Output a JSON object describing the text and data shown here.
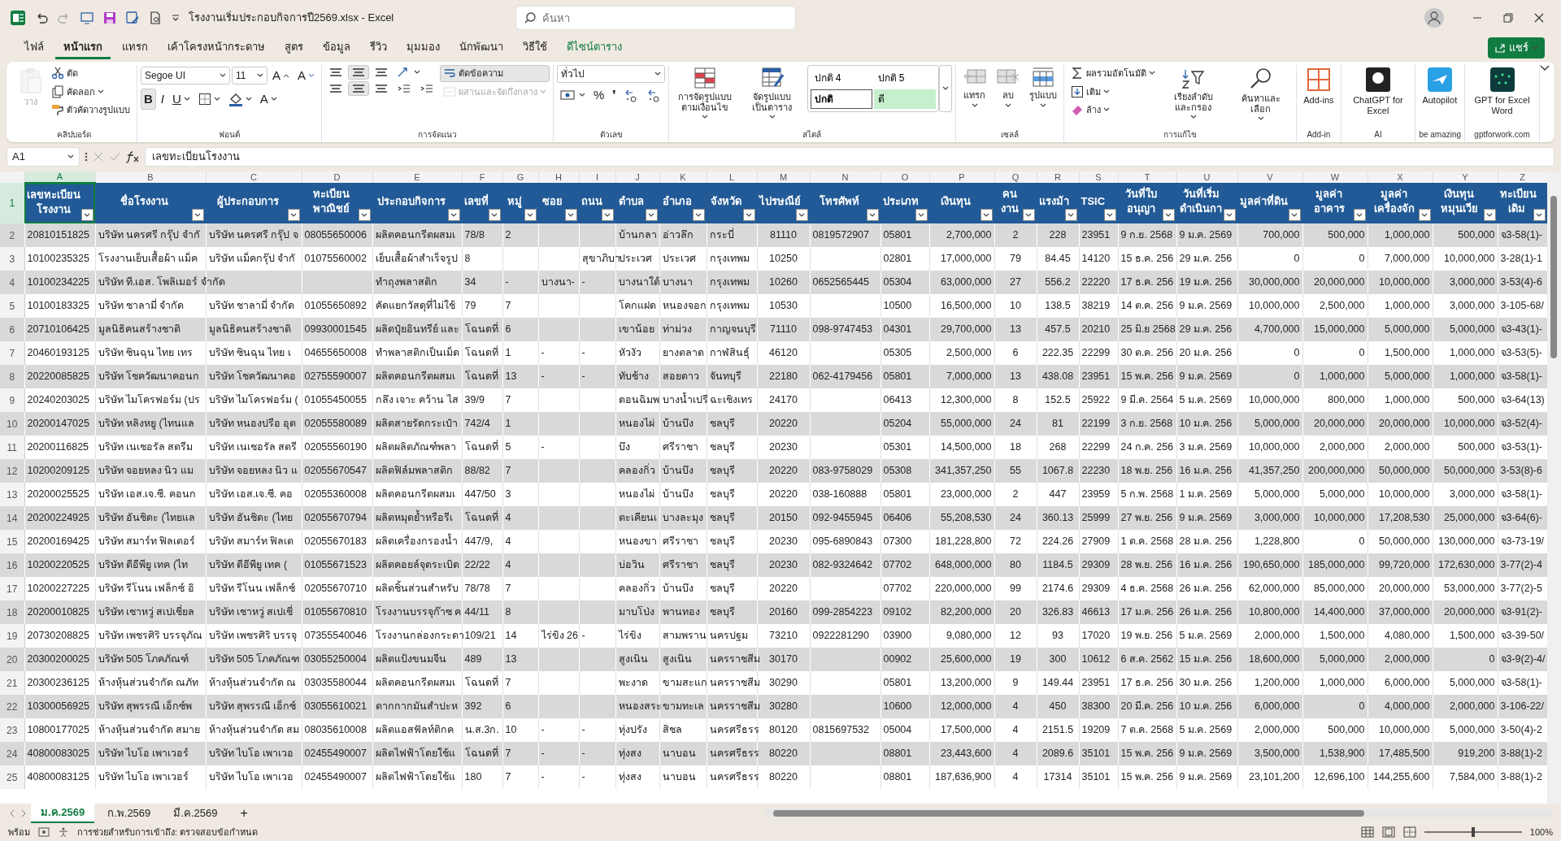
{
  "title_bar": {
    "title": "โรงงานเริ่มประกอบกิจการปี2569.xlsx  -  Excel",
    "search_placeholder": "ค้นหา"
  },
  "menu_tabs": [
    {
      "label": "ไฟล์",
      "selected": false,
      "kind": "tab"
    },
    {
      "label": "หน้าแรก",
      "selected": true,
      "kind": "tab"
    },
    {
      "label": "แทรก",
      "selected": false,
      "kind": "tab"
    },
    {
      "label": "เค้าโครงหน้ากระดาษ",
      "selected": false,
      "kind": "tab"
    },
    {
      "label": "สูตร",
      "selected": false,
      "kind": "tab"
    },
    {
      "label": "ข้อมูล",
      "selected": false,
      "kind": "tab"
    },
    {
      "label": "รีวิว",
      "selected": false,
      "kind": "tab"
    },
    {
      "label": "มุมมอง",
      "selected": false,
      "kind": "tab"
    },
    {
      "label": "นักพัฒนา",
      "selected": false,
      "kind": "tab"
    },
    {
      "label": "วิธีใช้",
      "selected": false,
      "kind": "tab"
    },
    {
      "label": "ดีไซน์ตาราง",
      "selected": false,
      "kind": "contextual"
    }
  ],
  "share_button": "แชร์",
  "ribbon": [
    {
      "label": "คลิปบอร์ด",
      "columns": [
        [
          {
            "kind": "paste",
            "label": "วาง",
            "disabled": true
          }
        ],
        [
          {
            "kind": "cut",
            "label": "ตัด",
            "disabled": false
          },
          {
            "kind": "copy",
            "label": "คัดลอก",
            "disabled": false
          },
          {
            "kind": "painter",
            "label": "ตัวคัดวางรูปแบบ",
            "disabled": false
          }
        ]
      ]
    },
    {
      "label": "ฟอนต์",
      "columns": [
        [
          [
            {
              "kind": "combo",
              "value": "Segoe UI",
              "disabled": false
            },
            {
              "kind": "combo",
              "value": "11",
              "disabled": false
            },
            {
              "kind": "grow",
              "label": "A",
              "disabled": false
            },
            {
              "kind": "shrink",
              "label": "A",
              "disabled": false
            }
          ],
          [
            {
              "kind": "bold",
              "label": "B",
              "on": true,
              "disabled": false
            },
            {
              "kind": "italic",
              "label": "I",
              "on": false,
              "disabled": false
            },
            {
              "kind": "underline",
              "label": "U",
              "on": false,
              "disabled": false
            },
            {
              "kind": "borders",
              "disabled": false
            },
            {
              "kind": "fill",
              "disabled": false
            },
            {
              "kind": "fontcolor",
              "label": "A",
              "disabled": false
            }
          ]
        ]
      ]
    },
    {
      "label": "การจัดแนว",
      "columns": [
        [
          [
            {
              "kind": "align",
              "on": false,
              "disabled": false
            },
            {
              "kind": "align",
              "on": true,
              "disabled": false
            },
            {
              "kind": "align",
              "on": false,
              "disabled": false
            },
            {
              "kind": "orient",
              "on": false,
              "disabled": false
            }
          ],
          [
            {
              "kind": "align",
              "on": false,
              "disabled": false
            },
            {
              "kind": "align",
              "on": true,
              "disabled": false
            },
            {
              "kind": "align",
              "on": false,
              "disabled": false
            },
            {
              "kind": "indent",
              "on": false,
              "disabled": false
            },
            {
              "kind": "indent",
              "on": false,
              "disabled": false
            }
          ]
        ],
        [
          {
            "kind": "wrap",
            "label": "ตัดข้อความ",
            "on": true,
            "disabled": false
          },
          {
            "kind": "merge",
            "label": "ผสานและจัดกึ่งกลาง",
            "on": false,
            "disabled": true
          }
        ]
      ]
    },
    {
      "label": "ตัวเลข",
      "columns": [
        [
          {
            "kind": "combo",
            "value": "ทั่วไป",
            "disabled": false
          },
          [
            {
              "kind": "currency",
              "disabled": false
            },
            {
              "kind": "char",
              "label": "%",
              "disabled": false
            },
            {
              "kind": "char",
              "label": "❜",
              "disabled": false
            },
            {
              "kind": "decimal",
              "disabled": false
            },
            {
              "kind": "decimal",
              "disabled": false
            }
          ]
        ]
      ]
    },
    {
      "label": "สไตล์",
      "columns": [
        [
          {
            "kind": "condformat",
            "label": "การจัดรูปแบบ ตามเงื่อนไข",
            "disabled": false
          }
        ],
        [
          {
            "kind": "tableformat",
            "label": "จัดรูปแบบ เป็นตาราง",
            "disabled": false
          }
        ],
        [
          {
            "kind": "gallery",
            "disabled": false,
            "styles": [
              {
                "label": "ปกติ 4",
                "color": "#ffffff",
                "selected": false
              },
              {
                "label": "ปกติ 5",
                "color": "#ffffff",
                "selected": false
              },
              {
                "label": "ปกติ",
                "color": "#ffffff",
                "selected": true
              },
              {
                "label": "ดี",
                "color": "#c6efce",
                "selected": false
              }
            ]
          }
        ]
      ]
    },
    {
      "label": "เซลล์",
      "columns": [
        [
          {
            "kind": "insert",
            "label": "แทรก",
            "disabled": false
          }
        ],
        [
          {
            "kind": "delete",
            "label": "ลบ",
            "disabled": false
          }
        ],
        [
          {
            "kind": "format",
            "label": "รูปแบบ",
            "disabled": false
          }
        ]
      ]
    },
    {
      "label": "การแก้ไข",
      "columns": [
        [
          {
            "kind": "autosum",
            "label": "ผลรวมอัตโนมัติ",
            "disabled": false
          },
          {
            "kind": "filldown",
            "label": "เติม",
            "disabled": false
          },
          {
            "kind": "clear",
            "label": "ล้าง",
            "disabled": false
          }
        ],
        [
          {
            "kind": "sort",
            "label": "เรียงลำดับ และกรอง",
            "disabled": false
          }
        ],
        [
          {
            "kind": "find",
            "label": "ค้นหาและ เลือก",
            "disabled": false
          }
        ]
      ]
    },
    {
      "label": "Add-in",
      "columns": [
        [
          {
            "kind": "addins",
            "label": "Add-ins",
            "disabled": false
          }
        ]
      ]
    },
    {
      "label": "AI",
      "columns": [
        [
          {
            "kind": "chatgpt",
            "label": "ChatGPT for Excel",
            "disabled": false
          }
        ]
      ]
    },
    {
      "label": "be amazing",
      "columns": [
        [
          {
            "kind": "autopilot",
            "label": "Autopilot",
            "disabled": false
          }
        ]
      ]
    },
    {
      "label": "gptforwork.com",
      "columns": [
        [
          {
            "kind": "gptword",
            "label": "GPT for Excel Word",
            "disabled": false
          }
        ]
      ]
    }
  ],
  "formula_bar": {
    "name_box": "A1",
    "content": "เลขทะเบียนโรงงาน"
  },
  "sheet": {
    "columns": [
      {
        "letter": "A",
        "heading": "เลขทะเบียนโรงงาน",
        "selected": true
      },
      {
        "letter": "B",
        "heading": "ชื่อโรงงาน",
        "selected": false
      },
      {
        "letter": "C",
        "heading": "ผู้ประกอบการ",
        "selected": false
      },
      {
        "letter": "D",
        "heading": "ทะเบียนพาณิชย์",
        "selected": false
      },
      {
        "letter": "E",
        "heading": "ประกอบกิจการ",
        "selected": false
      },
      {
        "letter": "F",
        "heading": "เลขที่",
        "selected": false
      },
      {
        "letter": "G",
        "heading": "หมู่",
        "selected": false
      },
      {
        "letter": "H",
        "heading": "ซอย",
        "selected": false
      },
      {
        "letter": "I",
        "heading": "ถนน",
        "selected": false
      },
      {
        "letter": "J",
        "heading": "ตำบล",
        "selected": false
      },
      {
        "letter": "K",
        "heading": "อำเภอ",
        "selected": false
      },
      {
        "letter": "L",
        "heading": "จังหวัด",
        "selected": false
      },
      {
        "letter": "M",
        "heading": "ไปรษณีย์",
        "selected": false
      },
      {
        "letter": "N",
        "heading": "โทรศัพท์",
        "selected": false
      },
      {
        "letter": "O",
        "heading": "ประเภท",
        "selected": false
      },
      {
        "letter": "P",
        "heading": "เงินทุน",
        "selected": false
      },
      {
        "letter": "Q",
        "heading": "คนงาน",
        "selected": false
      },
      {
        "letter": "R",
        "heading": "แรงม้า",
        "selected": false
      },
      {
        "letter": "S",
        "heading": "TSIC",
        "selected": false
      },
      {
        "letter": "T",
        "heading": "วันที่ใบอนุญา",
        "selected": false
      },
      {
        "letter": "U",
        "heading": "วันที่เริ่มดำเนินกา",
        "selected": false
      },
      {
        "letter": "V",
        "heading": "มูลค่าที่ดิน",
        "selected": false
      },
      {
        "letter": "W",
        "heading": "มูลค่าอาคาร",
        "selected": false
      },
      {
        "letter": "X",
        "heading": "มูลค่าเครื่องจัก",
        "selected": false
      },
      {
        "letter": "Y",
        "heading": "เงินทุนหมุนเวีย",
        "selected": false
      },
      {
        "letter": "Z",
        "heading": "ทะเบียนเดิม",
        "selected": false
      }
    ],
    "header_row": {
      "number": "1",
      "selected": true
    },
    "rows": [
      {
        "number": "2",
        "selected": false,
        "cells": [
          "20810151825",
          "บริษัท นครศรี กรุ๊ป จำกั",
          "บริษัท นครศรี กรุ๊ป จ",
          "08055650006",
          "ผลิตคอนกรีตผสมเ",
          "78/8",
          "2",
          "",
          "",
          "บ้านกลา",
          "อ่าวลึก",
          "กระบี่",
          "81110",
          "0819572907",
          "05801",
          "2,700,000",
          "2",
          "228",
          "23951",
          "9 ก.ย. 2568",
          "9 ม.ค. 2569",
          "700,000",
          "500,000",
          "1,000,000",
          "500,000",
          "จ3-58(1)-"
        ]
      },
      {
        "number": "3",
        "selected": false,
        "cells": [
          "10100235325",
          "โรงงานเย็บเสื้อผ้า แม็ค",
          "บริษัท  แม็คกรุ๊ป จำกั",
          "01075560002",
          "เย็บเสื้อผ้าสำเร็จรูป",
          "8",
          "",
          "",
          "สุขาภิบา",
          "ประเวศ",
          "ประเวศ",
          "กรุงเทพม",
          "10250",
          "",
          "02801",
          "17,000,000",
          "79",
          "84.45",
          "14120",
          "15 ธ.ค. 256",
          "29 ม.ค. 256",
          "0",
          "0",
          "7,000,000",
          "10,000,000",
          "3-28(1)-1"
        ]
      },
      {
        "number": "4",
        "selected": false,
        "cells": [
          "10100234225",
          "บริษัท ที.เอส. โพลิเมอร์ จำกัด",
          "",
          "",
          "ทำถุงพลาสติก",
          "34",
          "-",
          "บางนา-",
          "-",
          "บางนาใต้",
          "บางนา",
          "กรุงเทพม",
          "10260",
          "0652565445",
          "05304",
          "63,000,000",
          "27",
          "556.2",
          "22220",
          "17 ธ.ค. 256",
          "19 ม.ค. 256",
          "30,000,000",
          "20,000,000",
          "10,000,000",
          "3,000,000",
          "3-53(4)-6"
        ]
      },
      {
        "number": "5",
        "selected": false,
        "cells": [
          "10100183325",
          "บริษัท ชาลามี่ จำกัด",
          "บริษัท ชาลามี่ จำกัด",
          "01055650892",
          "คัดแยกวัสดุที่ไม่ใช้",
          "79",
          "7",
          "",
          "",
          "โคกแฝด",
          "หนองจอก",
          "กรุงเทพม",
          "10530",
          "",
          "10500",
          "16,500,000",
          "10",
          "138.5",
          "38219",
          "14 ต.ค. 256",
          "9 ม.ค. 2569",
          "10,000,000",
          "2,500,000",
          "1,000,000",
          "3,000,000",
          "3-105-68/"
        ]
      },
      {
        "number": "6",
        "selected": false,
        "cells": [
          "20710106425",
          "มูลนิธิคนสร้างชาติ",
          "มูลนิธิคนสร้างชาติ",
          "09930001545",
          "ผลิตปุ๋ยอินทรีย์ และ",
          "โฉนดที่",
          "6",
          "",
          "",
          "เขาน้อย",
          "ท่าม่วง",
          "กาญจนบุรี",
          "71110",
          "098-9747453",
          "04301",
          "29,700,000",
          "13",
          "457.5",
          "20210",
          "25 มิ.ย 2568",
          "29 ม.ค. 256",
          "4,700,000",
          "15,000,000",
          "5,000,000",
          "5,000,000",
          "จ3-43(1)-"
        ]
      },
      {
        "number": "7",
        "selected": false,
        "cells": [
          "20460193125",
          "บริษัท ซินฉุน ไทย เทร",
          "บริษัท ซินฉุน ไทย เ",
          "04655650008",
          "ทำพลาสติกเป็นเม็ด",
          "โฉนดที่",
          "1",
          "-",
          "-",
          "หัวงัว",
          "ยางตลาด",
          "กาฬสินธุ์",
          "46120",
          "",
          "05305",
          "2,500,000",
          "6",
          "222.35",
          "22299",
          "30 ต.ค. 256",
          "20 ม.ค. 256",
          "0",
          "0",
          "1,500,000",
          "1,000,000",
          "จ3-53(5)-"
        ]
      },
      {
        "number": "8",
        "selected": false,
        "cells": [
          "20220085825",
          "บริษัท โชควัฒนาคอนก",
          "บริษัท โชควัฒนาคอ",
          "02755590007",
          "ผลิตคอนกรีตผสมเ",
          "โฉนดที่",
          "13",
          "-",
          "-",
          "ทับช้าง",
          "สอยดาว",
          "จันทบุรี",
          "22180",
          "062-4179456",
          "05801",
          "7,000,000",
          "13",
          "438.08",
          "23951",
          "15 พ.ค. 256",
          "9 ม.ค. 2569",
          "0",
          "1,000,000",
          "5,000,000",
          "1,000,000",
          "จ3-58(1)-"
        ]
      },
      {
        "number": "9",
        "selected": false,
        "cells": [
          "20240203025",
          "บริษัท ไมโครฟอร์ม (ปร",
          "บริษัท ไมโครฟอร์ม (",
          "01055450055",
          "กลึง เจาะ คว้าน ไส",
          "39/9",
          "7",
          "",
          "",
          "ดอนฉิมพ",
          "บางน้ำเปรี",
          "ฉะเชิงเทร",
          "24170",
          "",
          "06413",
          "12,300,000",
          "8",
          "152.5",
          "25922",
          "9 มี.ค. 2564",
          "5 ม.ค. 2569",
          "10,000,000",
          "800,000",
          "1,000,000",
          "500,000",
          "จ3-64(13)"
        ]
      },
      {
        "number": "10",
        "selected": false,
        "cells": [
          "20200147025",
          "บริษัท หลิงหยู (ไทนแล",
          "บริษัท หนองปรือ อุต",
          "02055580089",
          "ผลิตสายรัดกระเป๋า",
          "742/4",
          "1",
          "",
          "",
          "หนองไผ่",
          "บ้านบึง",
          "ชลบุรี",
          "20220",
          "",
          "05204",
          "55,000,000",
          "24",
          "81",
          "22199",
          "3 ก.ย. 2568",
          "10 ม.ค. 256",
          "5,000,000",
          "20,000,000",
          "20,000,000",
          "10,000,000",
          "จ3-52(4)-"
        ]
      },
      {
        "number": "11",
        "selected": false,
        "cells": [
          "20200116825",
          "บริษัท เนเชอรัล สตรีม",
          "บริษัท เนเชอรัล สตรี",
          "02055560190",
          "ผลิตผลิตภัณฑ์พลา",
          "โฉนดที่",
          "5",
          "-",
          "",
          "บึง",
          "ศรีราชา",
          "ชลบุรี",
          "20230",
          "",
          "05301",
          "14,500,000",
          "18",
          "268",
          "22299",
          "24 ก.ค. 256",
          "3 ม.ค. 2569",
          "10,000,000",
          "2,000,000",
          "2,000,000",
          "500,000",
          "จ3-53(1)-"
        ]
      },
      {
        "number": "12",
        "selected": false,
        "cells": [
          "10200209125",
          "บริษัท จอยหลง นิว แม",
          "บริษัท จอยหลง นิว แ",
          "02055670547",
          "ผลิตฟิล์มพลาสติก",
          "88/82",
          "7",
          "",
          "",
          "คลองกิ่ว",
          "บ้านบึง",
          "ชลบุรี",
          "20220",
          "083-9758029",
          "05308",
          "341,357,250",
          "55",
          "1067.8",
          "22230",
          "18 พ.ย. 256",
          "16 ม.ค. 256",
          "41,357,250",
          "200,000,000",
          "50,000,000",
          "50,000,000",
          "3-53(8)-6"
        ]
      },
      {
        "number": "13",
        "selected": false,
        "cells": [
          "20200025525",
          "บริษัท เอส.เจ.ซี. คอนก",
          "บริษัท เอส.เจ.ซี. คอ",
          "02055360008",
          "ผลิตคอนกรีตผสมเ",
          "447/50",
          "3",
          "",
          "",
          "หนองไผ่",
          "บ้านบึง",
          "ชลบุรี",
          "20220",
          "038-160888",
          "05801",
          "23,000,000",
          "2",
          "447",
          "23959",
          "5 ก.พ. 2568",
          "1 ม.ค. 2569",
          "5,000,000",
          "5,000,000",
          "10,000,000",
          "3,000,000",
          "จ3-58(1)-"
        ]
      },
      {
        "number": "14",
        "selected": false,
        "cells": [
          "20200224925",
          "บริษัท อันชิดะ (ไทยแล",
          "บริษัท อันชิดะ (ไทย",
          "02055670794",
          "ผลิตหมุดย้ำหรือรีเ",
          "โฉนดที่",
          "4",
          "",
          "",
          "ตะเคียนเ",
          "บางละมุง",
          "ชลบุรี",
          "20150",
          "092-9455945",
          "06406",
          "55,208,530",
          "24",
          "360.13",
          "25999",
          "27 พ.ย. 256",
          "9 ม.ค. 2569",
          "3,000,000",
          "10,000,000",
          "17,208,530",
          "25,000,000",
          "จ3-64(6)-"
        ]
      },
      {
        "number": "15",
        "selected": false,
        "cells": [
          "20200169425",
          "บริษัท สมาร์ท ฟิลเตอร์",
          "บริษัท สมาร์ท ฟิลเต",
          "02055670183",
          "ผลิตเครื่องกรองน้ำ",
          "447/9,",
          "4",
          "",
          "",
          "หนองขา",
          "ศรีราชา",
          "ชลบุรี",
          "20230",
          "095-6890843",
          "07300",
          "181,228,800",
          "72",
          "224.26",
          "27909",
          "1 ต.ค. 2568",
          "28 ม.ค. 256",
          "1,228,800",
          "0",
          "50,000,000",
          "130,000,000",
          "จ3-73-19/"
        ]
      },
      {
        "number": "16",
        "selected": false,
        "cells": [
          "10200220525",
          "บริษัท ดีอีพียู เทค (ไท",
          "บริษัท ดีอีพียู เทค (",
          "01055671523",
          "ผลิตคอยล์จุดระเบิด",
          "22/22",
          "4",
          "",
          "",
          "บ่อวิน",
          "ศรีราชา",
          "ชลบุรี",
          "20230",
          "082-9324642",
          "07702",
          "648,000,000",
          "80",
          "1184.5",
          "29309",
          "28 พ.ย. 256",
          "16 ม.ค. 256",
          "190,650,000",
          "185,000,000",
          "99,720,000",
          "172,630,000",
          "3-77(2)-4"
        ]
      },
      {
        "number": "17",
        "selected": false,
        "cells": [
          "10200227225",
          "บริษัท รีโนน เฟล็กซ์ อิ",
          "บริษัท รีโนน เฟล็กซ์",
          "02055670710",
          "ผลิตชิ้นส่วนสำหรับ",
          "78/78",
          "7",
          "",
          "",
          "คลองกิ่ว",
          "บ้านบึง",
          "ชลบุรี",
          "20220",
          "",
          "07702",
          "220,000,000",
          "99",
          "2174.6",
          "29309",
          "4 ธ.ค. 2568",
          "26 ม.ค. 256",
          "62,000,000",
          "85,000,000",
          "20,000,000",
          "53,000,000",
          "3-77(2)-5"
        ]
      },
      {
        "number": "18",
        "selected": false,
        "cells": [
          "20200010825",
          "บริษัท เชาหวู่ สเปเชี่ยล",
          "บริษัท เชาหวู่ สเปเชี่",
          "01055670810",
          "โรงงานบรรจุก๊าซ ค",
          "44/11",
          "8",
          "",
          "",
          "มาบโป่ง",
          "พานทอง",
          "ชลบุรี",
          "20160",
          "099-2854223",
          "09102",
          "82,200,000",
          "20",
          "326.83",
          "46613",
          "17 ม.ค. 256",
          "26 ม.ค. 256",
          "10,800,000",
          "14,400,000",
          "37,000,000",
          "20,000,000",
          "จ3-91(2)-"
        ]
      },
      {
        "number": "19",
        "selected": false,
        "cells": [
          "20730208825",
          "บริษัท เพชรศิริ บรรจุภัณ",
          "บริษัท เพชรศิริ บรรจุ",
          "07355540046",
          "โรงงานกล่องกระดา",
          "109/21",
          "14",
          "ไร่ขิง 26",
          "-",
          "ไร่ขิง",
          "สามพราน",
          "นครปฐม",
          "73210",
          "0922281290",
          "03900",
          "9,080,000",
          "12",
          "93",
          "17020",
          "19 พ.ย. 256",
          "5 ม.ค. 2569",
          "2,000,000",
          "1,500,000",
          "4,080,000",
          "1,500,000",
          "จ3-39-50/"
        ]
      },
      {
        "number": "20",
        "selected": false,
        "cells": [
          "20300200025",
          "บริษัท 505 โภคภัณฑ์",
          "บริษัท 505 โภคภัณฑ",
          "03055250004",
          "ผลิตแป้งขนมจีน",
          "489",
          "13",
          "",
          "",
          "สูงเนิน",
          "สูงเนิน",
          "นครราชสีม",
          "30170",
          "",
          "00902",
          "25,600,000",
          "19",
          "300",
          "10612",
          "6 ส.ค. 2562",
          "15 ม.ค. 256",
          "18,600,000",
          "5,000,000",
          "2,000,000",
          "0",
          "จ3-9(2)-4/"
        ]
      },
      {
        "number": "21",
        "selected": false,
        "cells": [
          "20300236125",
          "ห้างหุ้นส่วนจำกัด ณภัท",
          "ห้างหุ้นส่วนจำกัด ณ",
          "03035580044",
          "ผลิตคอนกรีตผสมเ",
          "โฉนดที่",
          "7",
          "",
          "",
          "พะงาด",
          "ขามสะแก",
          "นครราชสีม",
          "30290",
          "",
          "05801",
          "13,200,000",
          "9",
          "149.44",
          "23951",
          "17 ธ.ค. 256",
          "30 ม.ค. 256",
          "1,200,000",
          "1,000,000",
          "6,000,000",
          "5,000,000",
          "จ3-58(1)-"
        ]
      },
      {
        "number": "22",
        "selected": false,
        "cells": [
          "10300056925",
          "บริษัท สุพรรณี เอ็กซ์พ",
          "บริษัท สุพรรณี เอ็กซ์",
          "03055610021",
          "ตากกากมันสำปะห",
          "392",
          "6",
          "",
          "",
          "หนองสระ",
          "ขามทะเล",
          "นครราชสีม",
          "30280",
          "",
          "10600",
          "12,000,000",
          "4",
          "450",
          "38300",
          "20 มี.ค. 256",
          "10 ม.ค. 256",
          "6,000,000",
          "0",
          "4,000,000",
          "2,000,000",
          "3-106-22/"
        ]
      },
      {
        "number": "23",
        "selected": false,
        "cells": [
          "10800177025",
          "ห้างหุ้นส่วนจำกัด สมาย",
          "ห้างหุ้นส่วนจำกัด สม",
          "08035610008",
          "ผลิตแอสฟัลท์ติกค",
          "น.ส.3ก.",
          "10",
          "-",
          "-",
          "ทุ่งปรัง",
          "สิชล",
          "นครศรีธรร",
          "80120",
          "0815697532",
          "05004",
          "17,500,000",
          "4",
          "2151.5",
          "19209",
          "7 ต.ค. 2568",
          "5 ม.ค. 2569",
          "2,000,000",
          "500,000",
          "10,000,000",
          "5,000,000",
          "3-50(4)-2"
        ]
      },
      {
        "number": "24",
        "selected": false,
        "cells": [
          "40800083025",
          "บริษัท ไบโอ เพาเวอร์",
          "บริษัท ไบโอ เพาเวอ",
          "02455490007",
          "ผลิตไฟฟ้าโดยใช้แ",
          "โฉนดที่",
          "7",
          "-",
          "-",
          "ทุ่งสง",
          "นาบอน",
          "นครศรีธรร",
          "80220",
          "",
          "08801",
          "23,443,600",
          "4",
          "2089.6",
          "35101",
          "15 พ.ค. 256",
          "9 ม.ค. 2569",
          "3,500,000",
          "1,538,900",
          "17,485,500",
          "919,200",
          "3-88(1)-2"
        ]
      },
      {
        "number": "25",
        "selected": false,
        "cells": [
          "40800083125",
          "บริษัท ไบโอ เพาเวอร์",
          "บริษัท ไบโอ เพาเวอ",
          "02455490007",
          "ผลิตไฟฟ้าโดยใช้แ",
          "180",
          "7",
          "-",
          "-",
          "ทุ่งสง",
          "นาบอน",
          "นครศรีธรร",
          "80220",
          "",
          "08801",
          "187,636,900",
          "4",
          "17314",
          "35101",
          "15 พ.ค. 256",
          "9 ม.ค. 2569",
          "23,101,200",
          "12,696,100",
          "144,255,600",
          "7,584,000",
          "3-88(1)-2"
        ]
      }
    ]
  },
  "sheet_tabs": [
    {
      "label": "ม.ค.2569",
      "selected": true
    },
    {
      "label": "ก.พ.2569",
      "selected": false
    },
    {
      "label": "มี.ค.2569",
      "selected": false
    }
  ],
  "add_sheet": "+",
  "status_bar": {
    "mode": "พร้อม",
    "accessibility": "การช่วยสำหรับการเข้าถึง: ตรวจสอบข้อกำหนด",
    "zoom": "100%",
    "zoom_slider": {
      "level": 0.5
    }
  }
}
